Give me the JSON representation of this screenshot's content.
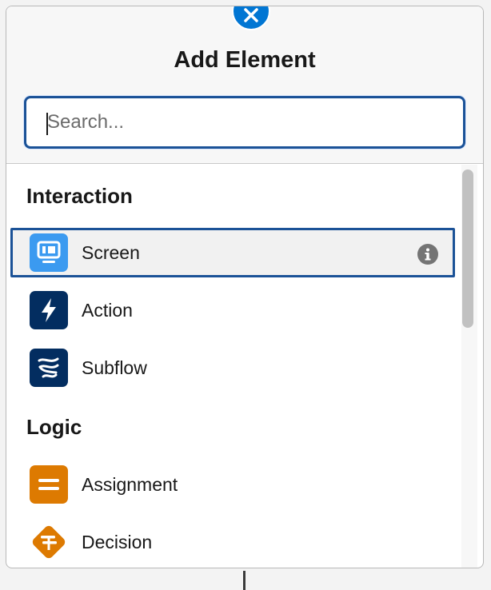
{
  "header": {
    "title": "Add Element"
  },
  "search": {
    "placeholder": "Search...",
    "value": ""
  },
  "sections": [
    {
      "title": "Interaction",
      "items": [
        {
          "label": "Screen",
          "icon": "screen-icon",
          "color": "#3b9af0",
          "selected": true
        },
        {
          "label": "Action",
          "icon": "lightning-icon",
          "color": "#032d60"
        },
        {
          "label": "Subflow",
          "icon": "subflow-icon",
          "color": "#032d60"
        }
      ]
    },
    {
      "title": "Logic",
      "items": [
        {
          "label": "Assignment",
          "icon": "assignment-icon",
          "color": "#dd7a01"
        },
        {
          "label": "Decision",
          "icon": "decision-icon",
          "color": "#dd7a01"
        }
      ]
    }
  ],
  "colors": {
    "accent": "#0176d3",
    "focus": "#1b5297",
    "navy": "#032d60",
    "orange": "#dd7a01"
  }
}
